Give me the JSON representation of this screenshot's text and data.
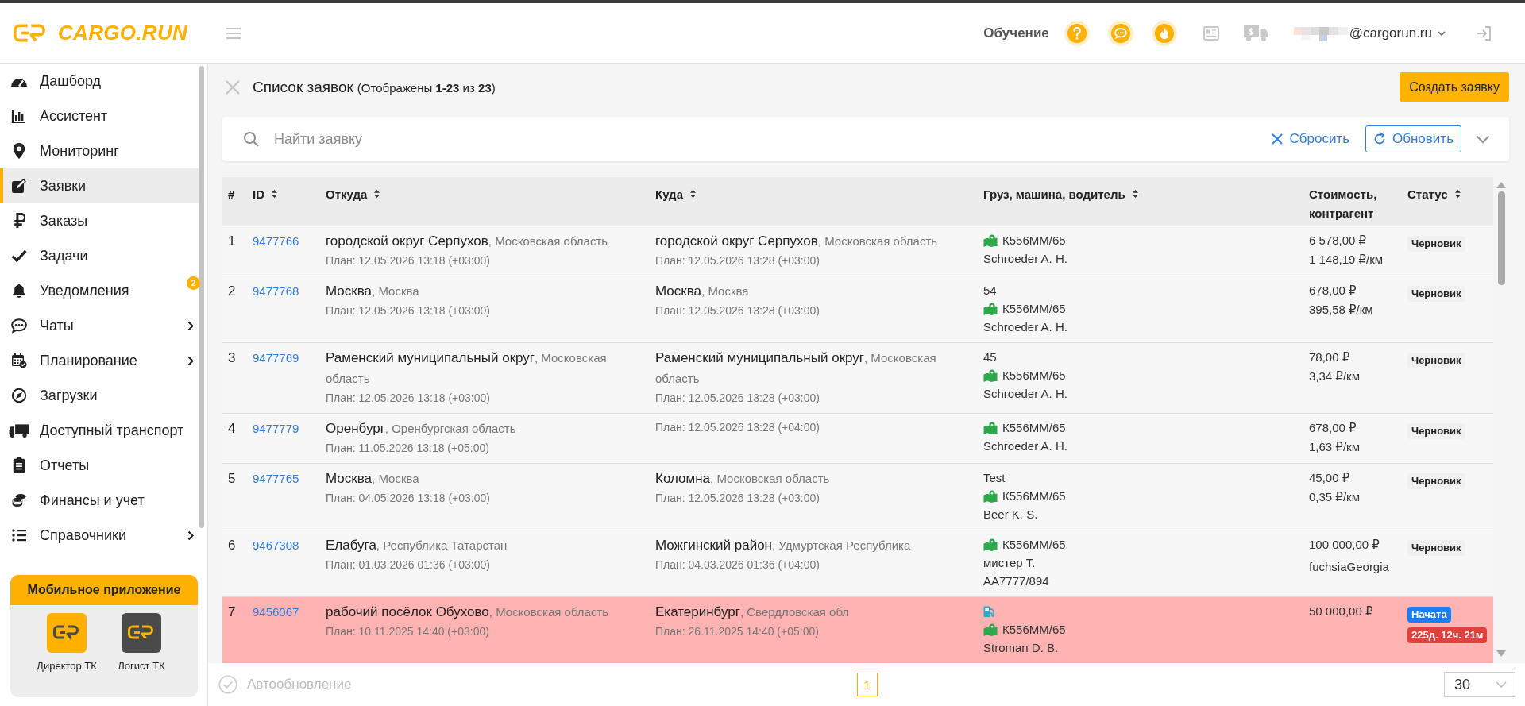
{
  "header": {
    "logo": "CARGO.RUN",
    "training": "Обучение",
    "email": "@cargorun.ru"
  },
  "sidebar": {
    "items": [
      {
        "label": "Дашборд",
        "selected": false,
        "submenu": false
      },
      {
        "label": "Ассистент",
        "selected": false,
        "submenu": false
      },
      {
        "label": "Мониторинг",
        "selected": false,
        "submenu": false
      },
      {
        "label": "Заявки",
        "selected": true,
        "submenu": false
      },
      {
        "label": "Заказы",
        "selected": false,
        "submenu": false
      },
      {
        "label": "Задачи",
        "selected": false,
        "submenu": false
      },
      {
        "label": "Уведомления",
        "selected": false,
        "submenu": false,
        "badge": "2"
      },
      {
        "label": "Чаты",
        "selected": false,
        "submenu": true
      },
      {
        "label": "Планирование",
        "selected": false,
        "submenu": true
      },
      {
        "label": "Загрузки",
        "selected": false,
        "submenu": false
      },
      {
        "label": "Доступный транспорт",
        "selected": false,
        "submenu": false
      },
      {
        "label": "Отчеты",
        "selected": false,
        "submenu": false
      },
      {
        "label": "Финансы и учет",
        "selected": false,
        "submenu": false
      },
      {
        "label": "Справочники",
        "selected": false,
        "submenu": true
      }
    ]
  },
  "mobile_app": {
    "title": "Мобильное приложение",
    "apps": [
      {
        "label": "Директор ТК",
        "color": "#ffb000"
      },
      {
        "label": "Логист ТК",
        "color": "#4a4a4a"
      }
    ]
  },
  "page": {
    "title": "Список заявок",
    "count": "(Отображены **1-23** из **23**)",
    "create_button": "Создать заявку"
  },
  "search": {
    "placeholder": "Найти заявку",
    "reset": "Сбросить",
    "refresh": "Обновить"
  },
  "table": {
    "columns": [
      {
        "label": "#",
        "sortable": false
      },
      {
        "label": "ID",
        "sortable": true
      },
      {
        "label": "Откуда",
        "sortable": true
      },
      {
        "label": "Куда",
        "sortable": true
      },
      {
        "label": "Груз, машина, водитель",
        "sortable": true
      },
      {
        "label": "Стоимость, контрагент",
        "sortable": false
      },
      {
        "label": "Статус",
        "sortable": true
      }
    ],
    "rows": [
      {
        "num": "1",
        "id": "9477766",
        "alert": false,
        "from": {
          "city": "городской округ Серпухов",
          "region": ", Московская область",
          "plan": "План: 12.05.2026 13:18 (+03:00)"
        },
        "to": {
          "city": "городской округ Серпухов",
          "region": ", Московская область",
          "plan": "План: 12.05.2026 13:28 (+03:00)"
        },
        "cargo": [
          {
            "kind": "vehicle",
            "text": "К556ММ/65"
          },
          {
            "kind": "text",
            "text": "Schroeder A. H."
          }
        ],
        "cost": [
          {
            "kind": "price",
            "text": "6 578,00 ₽"
          },
          {
            "kind": "rate",
            "text": "1 148,19 ₽/км"
          }
        ],
        "status": [
          {
            "kind": "draft",
            "label": "Черновик"
          }
        ]
      },
      {
        "num": "2",
        "id": "9477768",
        "alert": false,
        "from": {
          "city": "Москва",
          "region": ", Москва",
          "plan": "План: 12.05.2026 13:18 (+03:00)"
        },
        "to": {
          "city": "Москва",
          "region": ", Москва",
          "plan": "План: 12.05.2026 13:28 (+03:00)"
        },
        "cargo": [
          {
            "kind": "text",
            "text": "54"
          },
          {
            "kind": "vehicle",
            "text": "К556ММ/65"
          },
          {
            "kind": "text",
            "text": "Schroeder A. H."
          }
        ],
        "cost": [
          {
            "kind": "price",
            "text": "678,00 ₽"
          },
          {
            "kind": "rate",
            "text": "395,58 ₽/км"
          }
        ],
        "status": [
          {
            "kind": "draft",
            "label": "Черновик"
          }
        ]
      },
      {
        "num": "3",
        "id": "9477769",
        "alert": false,
        "from": {
          "city": "Раменский муниципальный округ",
          "region": ", Московская область",
          "plan": "План: 12.05.2026 13:18 (+03:00)"
        },
        "to": {
          "city": "Раменский муниципальный округ",
          "region": ", Московская область",
          "plan": "План: 12.05.2026 13:28 (+03:00)"
        },
        "cargo": [
          {
            "kind": "text",
            "text": "45"
          },
          {
            "kind": "vehicle",
            "text": "К556ММ/65"
          },
          {
            "kind": "text",
            "text": "Schroeder A. H."
          }
        ],
        "cost": [
          {
            "kind": "price",
            "text": "78,00 ₽"
          },
          {
            "kind": "rate",
            "text": "3,34 ₽/км"
          }
        ],
        "status": [
          {
            "kind": "draft",
            "label": "Черновик"
          }
        ]
      },
      {
        "num": "4",
        "id": "9477779",
        "alert": false,
        "from": {
          "city": "Оренбург",
          "region": ", Оренбургская область",
          "plan": "План: 11.05.2026 13:18 (+05:00)"
        },
        "to": {
          "plan": "План: 12.05.2026 13:28 (+04:00)"
        },
        "cargo": [
          {
            "kind": "vehicle",
            "text": "К556ММ/65"
          },
          {
            "kind": "text",
            "text": "Schroeder A. H."
          }
        ],
        "cost": [
          {
            "kind": "price",
            "text": "678,00 ₽"
          },
          {
            "kind": "rate",
            "text": "1,63 ₽/км"
          }
        ],
        "status": [
          {
            "kind": "draft",
            "label": "Черновик"
          }
        ]
      },
      {
        "num": "5",
        "id": "9477765",
        "alert": false,
        "from": {
          "city": "Москва",
          "region": ", Москва",
          "plan": "План: 04.05.2026 13:18 (+03:00)"
        },
        "to": {
          "city": "Коломна",
          "region": ", Московская область",
          "plan": "План: 12.05.2026 13:28 (+03:00)"
        },
        "cargo": [
          {
            "kind": "text",
            "text": "Test"
          },
          {
            "kind": "vehicle",
            "text": "К556ММ/65"
          },
          {
            "kind": "text",
            "text": "Beer K. S."
          }
        ],
        "cost": [
          {
            "kind": "price",
            "text": "45,00 ₽"
          },
          {
            "kind": "rate",
            "text": "0,35 ₽/км"
          }
        ],
        "status": [
          {
            "kind": "draft",
            "label": "Черновик"
          }
        ]
      },
      {
        "num": "6",
        "id": "9467308",
        "alert": false,
        "from": {
          "city": "Елабуга",
          "region": ", Республика Татарстан",
          "plan": "План: 01.03.2026 01:36 (+03:00)"
        },
        "to": {
          "city": "Можгинский район",
          "region": ", Удмуртская Республика",
          "plan": "План: 04.03.2026 01:36 (+04:00)"
        },
        "cargo": [
          {
            "kind": "vehicle",
            "text": "К556ММ/65"
          },
          {
            "kind": "text",
            "text": "мистер Т."
          },
          {
            "kind": "text",
            "text": "АА7777/894"
          }
        ],
        "cost": [
          {
            "kind": "price",
            "text": "100 000,00 ₽"
          },
          {
            "kind": "contractor",
            "text": "fuchsiaGeorgia"
          }
        ],
        "status": [
          {
            "kind": "draft",
            "label": "Черновик"
          }
        ]
      },
      {
        "num": "7",
        "id": "9456067",
        "alert": true,
        "from": {
          "city": "рабочий посёлок Обухово",
          "region": ", Московская область",
          "plan": "План: 10.11.2025 14:40 (+03:00)"
        },
        "to": {
          "city": "Екатеринбург",
          "region": ", Свердловская обл",
          "plan": "План: 26.11.2025 14:40 (+05:00)"
        },
        "cargo": [
          {
            "kind": "fuel"
          },
          {
            "kind": "vehicle",
            "text": "К556ММ/65"
          },
          {
            "kind": "text",
            "text": "Stroman D. B."
          }
        ],
        "cost": [
          {
            "kind": "price",
            "text": "50 000,00 ₽"
          }
        ],
        "status": [
          {
            "kind": "started",
            "label": "Начата"
          },
          {
            "kind": "timer",
            "label": "225д. 12ч. 21м"
          }
        ]
      }
    ]
  },
  "footer": {
    "autorefresh": {
      "label": "Автообновление",
      "checked": false
    },
    "pages": [
      {
        "label": "1",
        "selected": true
      }
    ],
    "per_page": "30"
  }
}
